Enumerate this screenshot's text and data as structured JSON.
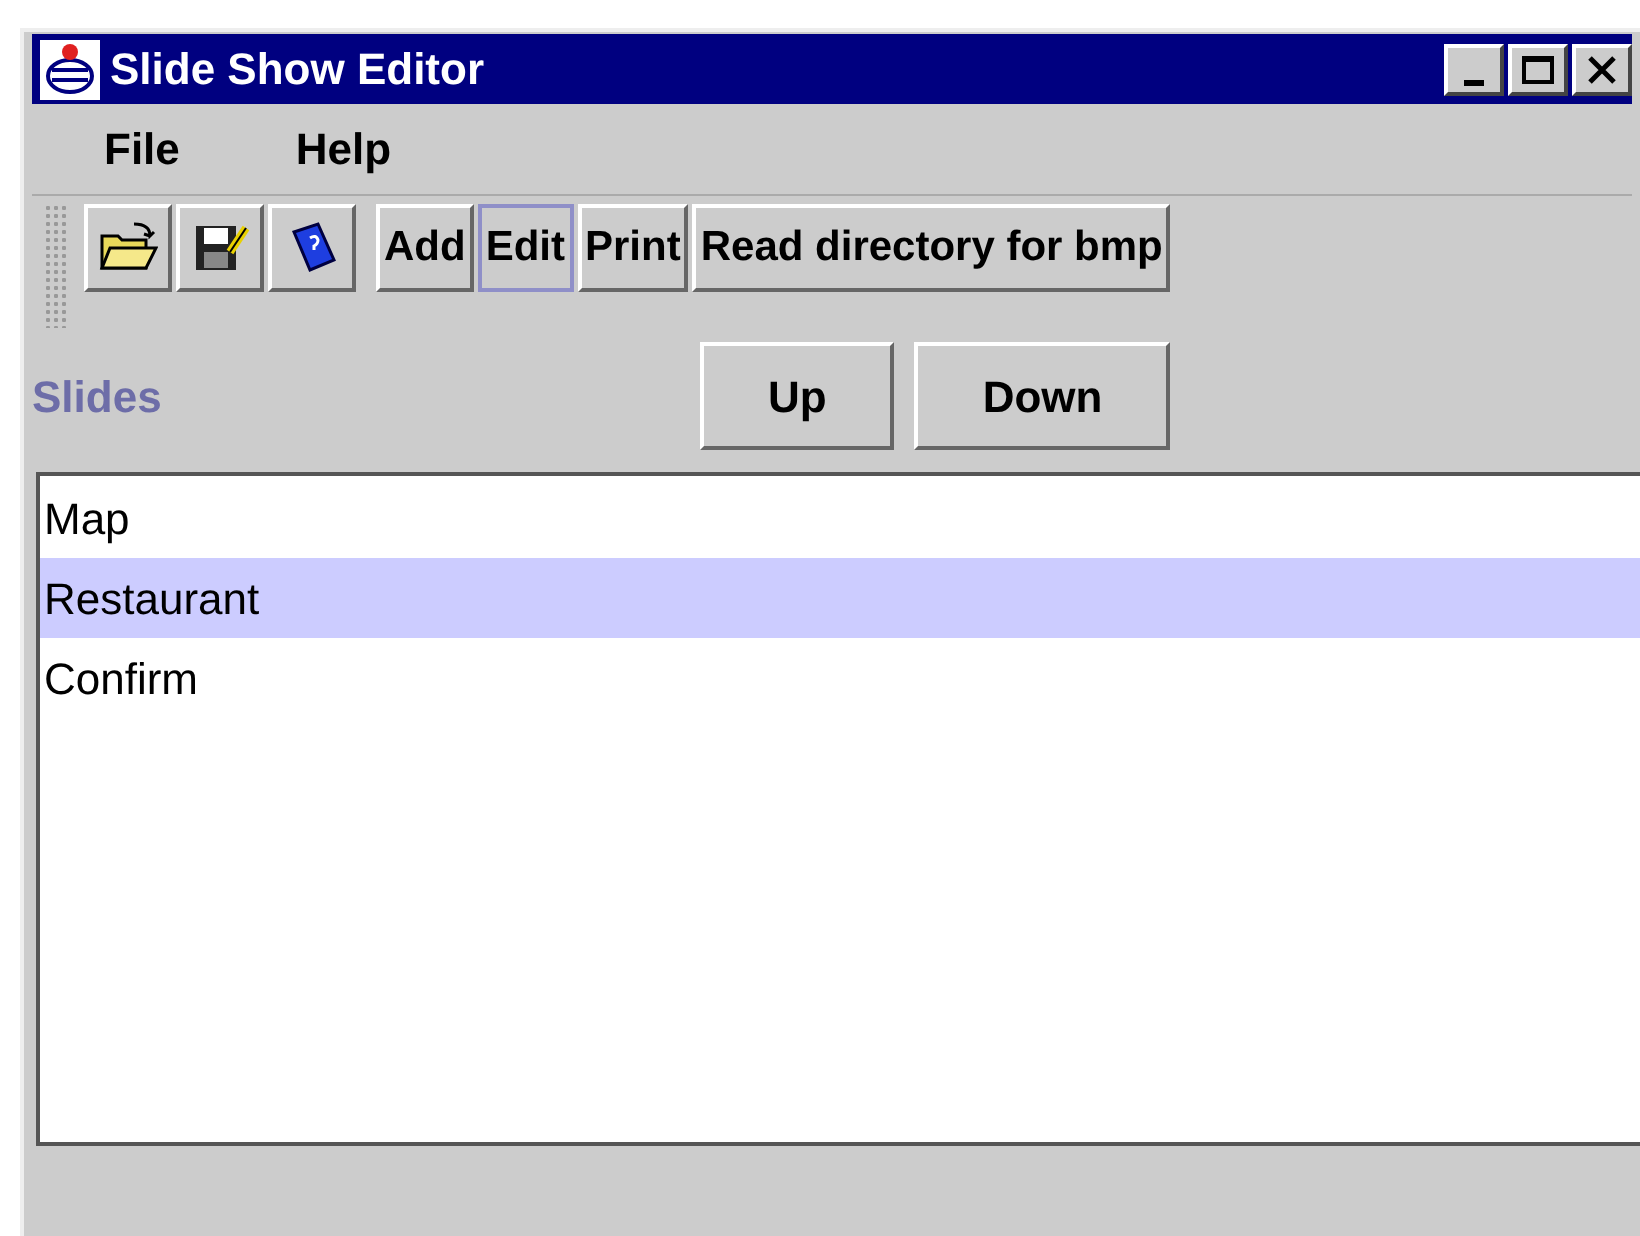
{
  "window": {
    "title": "Slide Show Editor"
  },
  "menu": [
    {
      "label": "File"
    },
    {
      "label": "Help"
    }
  ],
  "toolbar": [
    {
      "kind": "open",
      "focused": false
    },
    {
      "kind": "save",
      "focused": false
    },
    {
      "kind": "book",
      "focused": false
    },
    {
      "kind": "text",
      "label": "Add",
      "focused": false
    },
    {
      "kind": "text",
      "label": "Edit",
      "focused": true
    },
    {
      "kind": "text",
      "label": "Print",
      "focused": false
    },
    {
      "kind": "text",
      "label": "Read directory for bmp",
      "focused": false
    }
  ],
  "slides_label": "Slides",
  "order_buttons": [
    {
      "label": "Up"
    },
    {
      "label": "Down"
    }
  ],
  "slides": [
    {
      "label": "Map",
      "selected": false
    },
    {
      "label": "Restaurant",
      "selected": true
    },
    {
      "label": "Confirm",
      "selected": false
    }
  ]
}
